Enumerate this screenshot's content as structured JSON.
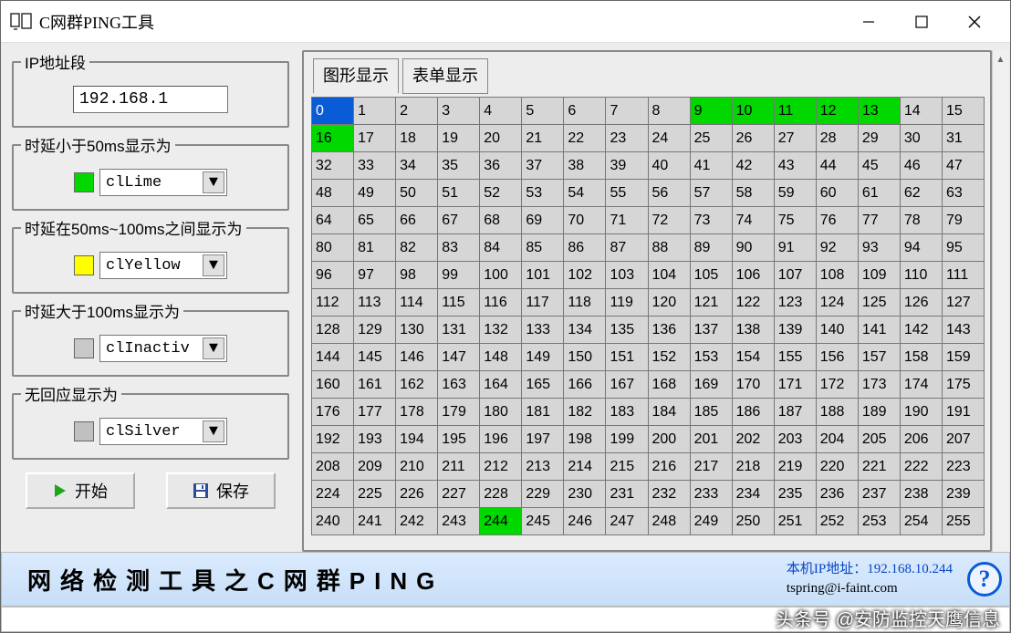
{
  "title": "C网群PING工具",
  "ip_segment": {
    "legend": "IP地址段",
    "value": "192.168.1"
  },
  "latency_low": {
    "legend": "时延小于50ms显示为",
    "color_name": "clLime",
    "swatch": "#00d800"
  },
  "latency_mid": {
    "legend": "时延在50ms~100ms之间显示为",
    "color_name": "clYellow",
    "swatch": "#ffff00"
  },
  "latency_high": {
    "legend": "时延大于100ms显示为",
    "color_name": "clInactiv",
    "swatch": "#c8c8c8"
  },
  "no_response": {
    "legend": "无回应显示为",
    "color_name": "clSilver",
    "swatch": "#c0c0c0"
  },
  "buttons": {
    "start": "开始",
    "save": "保存"
  },
  "tabs": {
    "graphic": "图形显示",
    "table": "表单显示"
  },
  "grid": {
    "count": 256,
    "blue_cells": [
      0
    ],
    "green_cells": [
      9,
      10,
      11,
      12,
      13,
      16,
      244
    ]
  },
  "footer": {
    "title": "网络检测工具之C网群PING",
    "local_ip_label": "本机IP地址：",
    "local_ip": "192.168.10.244",
    "email": "tspring@i-faint.com"
  },
  "watermark": "头条号 @安防监控天鹰信息"
}
